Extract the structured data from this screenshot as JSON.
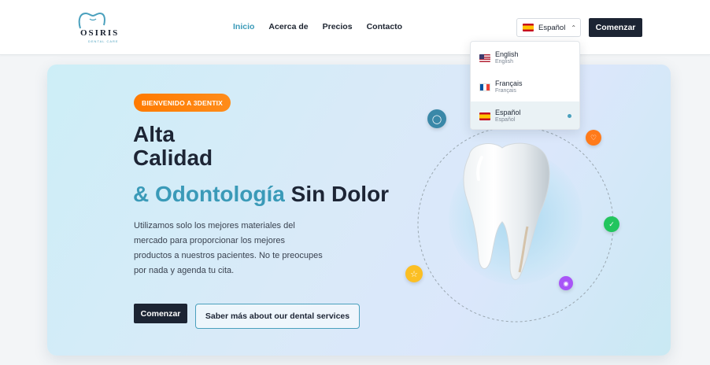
{
  "header": {
    "logo": {
      "name": "OSIRIS",
      "tagline": "DENTAL CARE"
    },
    "nav": [
      {
        "label": "Inicio",
        "active": true
      },
      {
        "label": "Acerca de",
        "active": false
      },
      {
        "label": "Precios",
        "active": false
      },
      {
        "label": "Contacto",
        "active": false
      }
    ],
    "language_button": {
      "label": "Español",
      "flag": "es-flag-icon"
    },
    "cta_label": "Comenzar"
  },
  "language_dropdown": {
    "items": [
      {
        "name": "English",
        "native": "English",
        "flag": "us-flag-icon",
        "selected": false
      },
      {
        "name": "Français",
        "native": "Français",
        "flag": "fr-flag-icon",
        "selected": false
      },
      {
        "name": "Español",
        "native": "Español",
        "flag": "es-flag-icon",
        "selected": true
      }
    ]
  },
  "hero": {
    "badge": "BIENVENIDO A 3DENTIX",
    "title_line1": "Alta",
    "title_line2": "Calidad",
    "title_accent": "& Odontología",
    "title_end": " Sin Dolor",
    "description": "Utilizamos solo los mejores materiales del mercado para proporcionar los mejores productos a nuestros pacientes. No te preocupes por nada y agenda tu cita.",
    "primary_button": "Comenzar",
    "secondary_button": "Saber más about our dental services",
    "floating_icons": [
      "tooth-icon",
      "heart-icon",
      "check-icon",
      "star-icon",
      "eye-icon"
    ]
  },
  "colors": {
    "accent": "#3a9ab8",
    "dark": "#1c2433",
    "badge_orange": "#ff7a00"
  }
}
